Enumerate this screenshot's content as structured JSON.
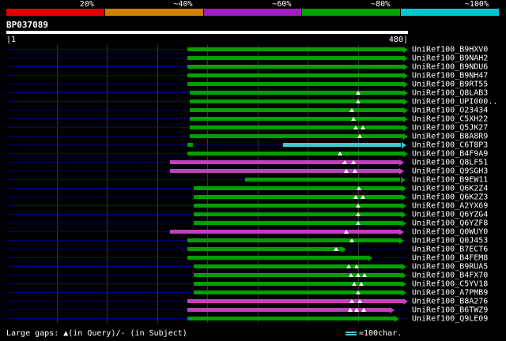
{
  "header": {
    "scale_labels": [
      "20%",
      "~40%",
      "~60%",
      "~80%",
      "~100%"
    ],
    "scale_colors": [
      "#e00000",
      "#d08000",
      "#a020c0",
      "#00a000",
      "#00c8d0"
    ]
  },
  "query": {
    "title": "BP037089",
    "ruler_left": "|1",
    "ruler_right": "480|"
  },
  "footer": {
    "gaps_legend": "Large gaps: ▲(in Query)/- (in Subject)",
    "scale_text": "=100char.",
    "scale_bar_color": "#40c8d0"
  },
  "chart_data": {
    "type": "bar",
    "subtype": "sequence-alignment-overview",
    "title": "BP037089",
    "x_range": [
      1,
      480
    ],
    "gridline_interval": 60,
    "legend_position": "top",
    "colors": {
      "green": "#00a000",
      "magenta": "#c040c0",
      "cyan": "#40c8d0",
      "query_line": "#000080",
      "gap_marker": "#ffffff"
    },
    "rows": [
      {
        "label": "UniRef100_B9HXV0",
        "segments": [
          {
            "from": 216,
            "to": 474,
            "color": "green"
          }
        ],
        "gaps": []
      },
      {
        "label": "UniRef100_B9NAH2",
        "segments": [
          {
            "from": 216,
            "to": 474,
            "color": "green"
          }
        ],
        "gaps": []
      },
      {
        "label": "UniRef100_B9NDU6",
        "segments": [
          {
            "from": 216,
            "to": 474,
            "color": "green"
          }
        ],
        "gaps": []
      },
      {
        "label": "UniRef100_B9NH47",
        "segments": [
          {
            "from": 216,
            "to": 474,
            "color": "green"
          }
        ],
        "gaps": []
      },
      {
        "label": "UniRef100_B9RT55",
        "segments": [
          {
            "from": 216,
            "to": 474,
            "color": "green"
          }
        ],
        "gaps": []
      },
      {
        "label": "UniRef100_Q8LAB3",
        "segments": [
          {
            "from": 219,
            "to": 474,
            "color": "green"
          }
        ],
        "gaps": [
          420
        ]
      },
      {
        "label": "UniRef100_UPI000..",
        "segments": [
          {
            "from": 219,
            "to": 474,
            "color": "green"
          }
        ],
        "gaps": [
          420
        ]
      },
      {
        "label": "UniRef100_O23434",
        "segments": [
          {
            "from": 219,
            "to": 474,
            "color": "green"
          }
        ],
        "gaps": [
          413
        ]
      },
      {
        "label": "UniRef100_C5XH22",
        "segments": [
          {
            "from": 219,
            "to": 474,
            "color": "green"
          }
        ],
        "gaps": [
          415
        ]
      },
      {
        "label": "UniRef100_Q5JK27",
        "segments": [
          {
            "from": 219,
            "to": 474,
            "color": "green"
          }
        ],
        "gaps": [
          418,
          426
        ]
      },
      {
        "label": "UniRef100_B8A8R9",
        "segments": [
          {
            "from": 219,
            "to": 474,
            "color": "green"
          }
        ],
        "gaps": [
          422
        ]
      },
      {
        "label": "UniRef100_C6T8P3",
        "segments": [
          {
            "from": 216,
            "to": 223,
            "color": "green"
          },
          {
            "from": 331,
            "to": 472,
            "color": "cyan"
          }
        ],
        "gaps": []
      },
      {
        "label": "UniRef100_B4F9A9",
        "segments": [
          {
            "from": 216,
            "to": 474,
            "color": "green"
          }
        ],
        "gaps": [
          399
        ]
      },
      {
        "label": "UniRef100_Q8LF51",
        "segments": [
          {
            "from": 196,
            "to": 470,
            "color": "magenta"
          }
        ],
        "gaps": [
          404,
          415
        ]
      },
      {
        "label": "UniRef100_Q9SGH3",
        "segments": [
          {
            "from": 196,
            "to": 470,
            "color": "magenta"
          }
        ],
        "gaps": [
          406,
          417
        ]
      },
      {
        "label": "UniRef100_B9EW11",
        "segments": [
          {
            "from": 285,
            "to": 471,
            "color": "green"
          }
        ],
        "gaps": []
      },
      {
        "label": "UniRef100_Q6K2Z4",
        "segments": [
          {
            "from": 224,
            "to": 472,
            "color": "green"
          }
        ],
        "gaps": [
          421
        ]
      },
      {
        "label": "UniRef100_Q6K2Z3",
        "segments": [
          {
            "from": 224,
            "to": 472,
            "color": "green"
          }
        ],
        "gaps": [
          418,
          426
        ]
      },
      {
        "label": "UniRef100_A2YX69",
        "segments": [
          {
            "from": 224,
            "to": 472,
            "color": "green"
          }
        ],
        "gaps": [
          420
        ]
      },
      {
        "label": "UniRef100_Q6YZG4",
        "segments": [
          {
            "from": 224,
            "to": 472,
            "color": "green"
          }
        ],
        "gaps": [
          420
        ]
      },
      {
        "label": "UniRef100_Q6YZF8",
        "segments": [
          {
            "from": 224,
            "to": 472,
            "color": "green"
          }
        ],
        "gaps": [
          420
        ]
      },
      {
        "label": "UniRef100_Q0WUY0",
        "segments": [
          {
            "from": 196,
            "to": 470,
            "color": "magenta"
          }
        ],
        "gaps": [
          406
        ]
      },
      {
        "label": "UniRef100_Q0J453",
        "segments": [
          {
            "from": 216,
            "to": 470,
            "color": "green"
          }
        ],
        "gaps": [
          413
        ]
      },
      {
        "label": "UniRef100_B7ECT6",
        "segments": [
          {
            "from": 216,
            "to": 401,
            "color": "green"
          }
        ],
        "gaps": [
          394
        ]
      },
      {
        "label": "UniRef100_B4FEM8",
        "segments": [
          {
            "from": 216,
            "to": 432,
            "color": "green"
          }
        ],
        "gaps": []
      },
      {
        "label": "UniRef100_B9RUA5",
        "segments": [
          {
            "from": 224,
            "to": 472,
            "color": "green"
          }
        ],
        "gaps": [
          409,
          419
        ]
      },
      {
        "label": "UniRef100_B4FX70",
        "segments": [
          {
            "from": 224,
            "to": 472,
            "color": "green"
          }
        ],
        "gaps": [
          412,
          420,
          428
        ]
      },
      {
        "label": "UniRef100_C5YV18",
        "segments": [
          {
            "from": 224,
            "to": 472,
            "color": "green"
          }
        ],
        "gaps": [
          416,
          424
        ]
      },
      {
        "label": "UniRef100_A7PMB9",
        "segments": [
          {
            "from": 224,
            "to": 472,
            "color": "green"
          }
        ],
        "gaps": [
          420
        ]
      },
      {
        "label": "UniRef100_B8A276",
        "segments": [
          {
            "from": 216,
            "to": 474,
            "color": "magenta"
          }
        ],
        "gaps": [
          413,
          422
        ]
      },
      {
        "label": "UniRef100_B6TWZ9",
        "segments": [
          {
            "from": 216,
            "to": 458,
            "color": "magenta"
          }
        ],
        "gaps": [
          411,
          419,
          427
        ]
      },
      {
        "label": "UniRef100_Q9LE09",
        "segments": [
          {
            "from": 216,
            "to": 464,
            "color": "green"
          }
        ],
        "gaps": []
      }
    ]
  }
}
